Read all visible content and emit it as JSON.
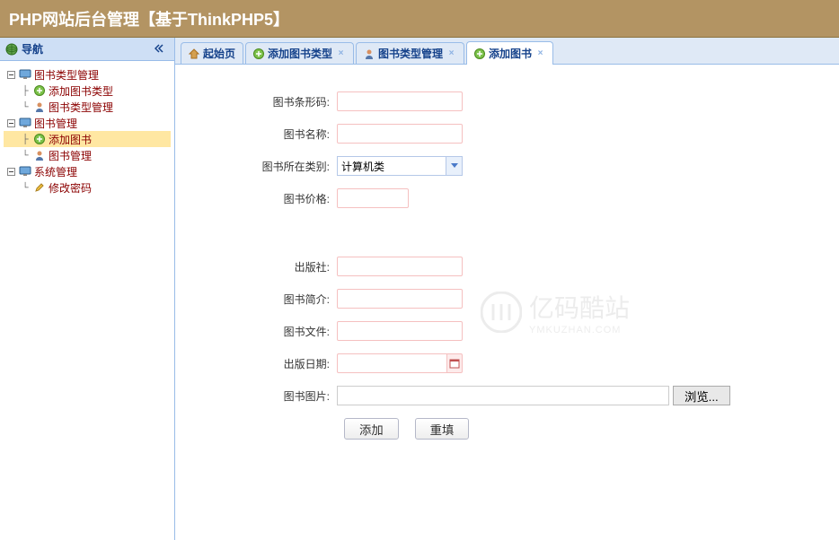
{
  "header": {
    "title": "PHP网站后台管理【基于ThinkPHP5】"
  },
  "sidebar": {
    "title": "导航",
    "nodes": [
      {
        "label": "图书类型管理",
        "level": 0,
        "icon": "monitor",
        "expandable": true
      },
      {
        "label": "添加图书类型",
        "level": 1,
        "icon": "plus"
      },
      {
        "label": "图书类型管理",
        "level": 1,
        "icon": "person"
      },
      {
        "label": "图书管理",
        "level": 0,
        "icon": "monitor",
        "expandable": true
      },
      {
        "label": "添加图书",
        "level": 1,
        "icon": "plus",
        "selected": true
      },
      {
        "label": "图书管理",
        "level": 1,
        "icon": "person"
      },
      {
        "label": "系统管理",
        "level": 0,
        "icon": "monitor",
        "expandable": true
      },
      {
        "label": "修改密码",
        "level": 1,
        "icon": "pencil"
      }
    ]
  },
  "tabs": [
    {
      "label": "起始页",
      "icon": "home",
      "closable": false
    },
    {
      "label": "添加图书类型",
      "icon": "plus",
      "closable": true
    },
    {
      "label": "图书类型管理",
      "icon": "person",
      "closable": true
    },
    {
      "label": "添加图书",
      "icon": "plus",
      "closable": true,
      "active": true
    }
  ],
  "form": {
    "fields": {
      "barcode": {
        "label": "图书条形码:"
      },
      "name": {
        "label": "图书名称:"
      },
      "category": {
        "label": "图书所在类别:",
        "value": "计算机类"
      },
      "price": {
        "label": "图书价格:"
      },
      "publisher": {
        "label": "出版社:"
      },
      "intro": {
        "label": "图书简介:"
      },
      "file": {
        "label": "图书文件:"
      },
      "pubdate": {
        "label": "出版日期:"
      },
      "image": {
        "label": "图书图片:",
        "browse": "浏览..."
      }
    },
    "buttons": {
      "submit": "添加",
      "reset": "重填"
    }
  },
  "watermark": {
    "main": "亿码酷站",
    "sub": "YMKUZHAN.COM"
  }
}
